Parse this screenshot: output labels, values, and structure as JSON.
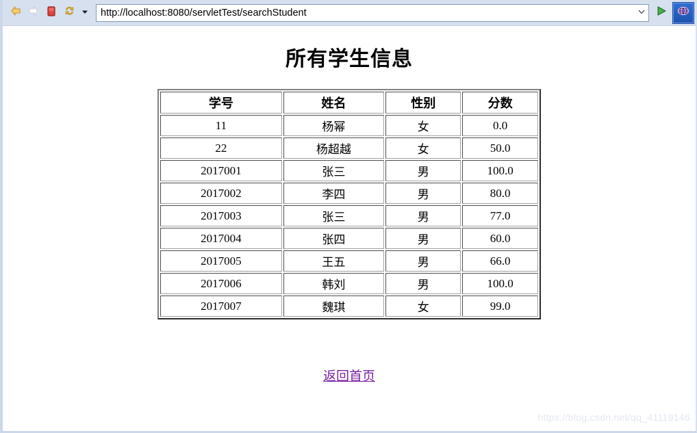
{
  "browser": {
    "toolbar": {
      "back_icon": "arrow-left-icon",
      "forward_icon": "arrow-right-icon",
      "stop_icon": "stop-square-icon",
      "refresh_icon": "refresh-icon",
      "history_caret_icon": "chevron-down-icon",
      "url_dropdown_icon": "chevron-down-icon",
      "go_icon": "go-play-icon",
      "app_icon": "browser-globe-icon"
    },
    "address_bar": {
      "value": "http://localhost:8080/servletTest/searchStudent",
      "placeholder": "http://"
    },
    "colors": {
      "toolbar_bg": "#d6e0ef",
      "url_border": "#7f9db9",
      "back_arrow": "#f2c14a",
      "forward_arrow": "#d9d9d9",
      "stop_square": "#e24a4a",
      "refresh_arrows": "#f0c040",
      "go_arrow": "#3a9c3a",
      "app_button": "#1d52ae"
    }
  },
  "page": {
    "title": "所有学生信息",
    "home_link": "返回首页",
    "watermark": "https://blog.csdn.net/qq_41119146",
    "link_color": "#7b1fa2",
    "table": {
      "headers": [
        "学号",
        "姓名",
        "性别",
        "分数"
      ],
      "rows": [
        [
          "11",
          "杨幂",
          "女",
          "0.0"
        ],
        [
          "22",
          "杨超越",
          "女",
          "50.0"
        ],
        [
          "2017001",
          "张三",
          "男",
          "100.0"
        ],
        [
          "2017002",
          "李四",
          "男",
          "80.0"
        ],
        [
          "2017003",
          "张三",
          "男",
          "77.0"
        ],
        [
          "2017004",
          "张四",
          "男",
          "60.0"
        ],
        [
          "2017005",
          "王五",
          "男",
          "66.0"
        ],
        [
          "2017006",
          "韩刘",
          "男",
          "100.0"
        ],
        [
          "2017007",
          "魏琪",
          "女",
          "99.0"
        ]
      ]
    }
  }
}
